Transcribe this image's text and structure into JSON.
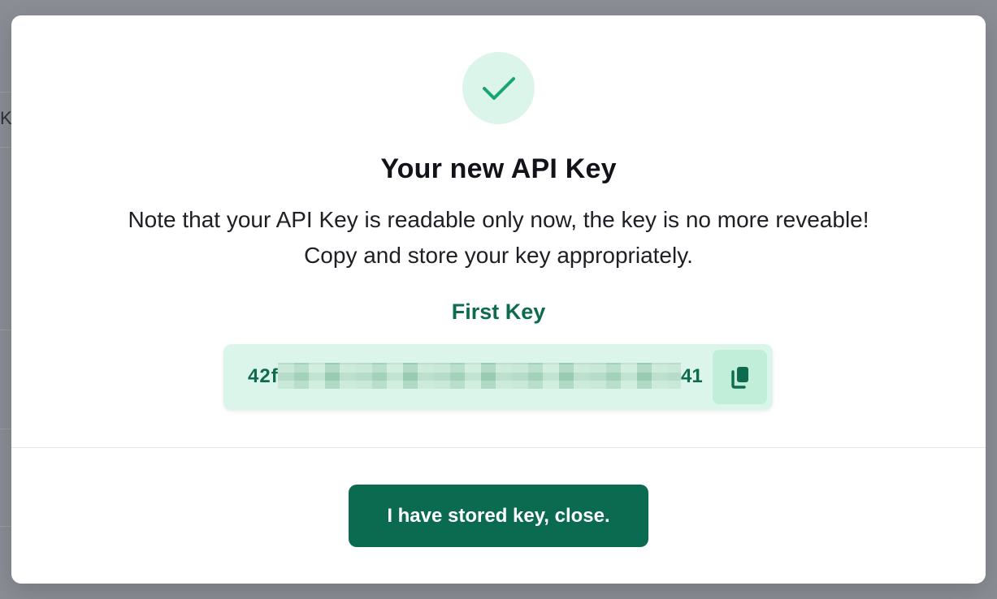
{
  "background": {
    "partial_char": "K"
  },
  "modal": {
    "icon": "check-icon",
    "title": "Your new API Key",
    "description_line1": "Note that your API Key is readable only now, the key is no more reveable!",
    "description_line2": "Copy and store your key appropriately.",
    "key_label": "First Key",
    "key_value_prefix": "42f",
    "key_value_suffix": "41",
    "copy_icon": "copy-icon",
    "close_button_label": "I have stored key, close."
  },
  "colors": {
    "accent": "#0b6b50",
    "accent_light": "#dcf5ea",
    "check": "#17a572"
  }
}
